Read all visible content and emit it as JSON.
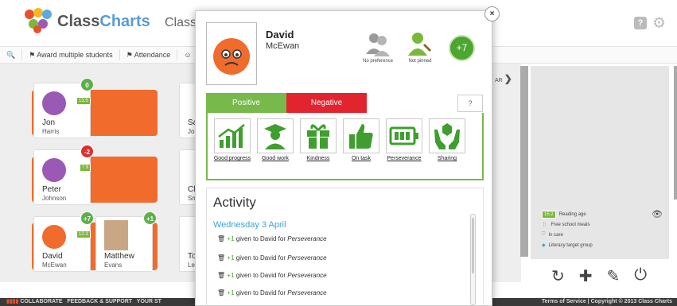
{
  "app": {
    "logo_prefix": "Class",
    "logo_suffix": "Charts",
    "class_title": "Classe",
    "help_label": "?"
  },
  "toolbar": {
    "award_label": "Award multiple students",
    "attendance_label": "Attendance"
  },
  "students": [
    {
      "first": "Jon",
      "last": "Harris",
      "points": "0",
      "reading_age": "13.5",
      "face_color": "#9b59b6",
      "bubble_color": "#5cb04a"
    },
    {
      "first": "Peter",
      "last": "Johnson",
      "points": "-2",
      "reading_age": "7.9",
      "face_color": "#9b59b6",
      "bubble_color": "#d9302f"
    },
    {
      "first": "David",
      "last": "McEwan",
      "points": "+7",
      "reading_age": "12.3",
      "face_color": "#f06b2c",
      "bubble_color": "#5cb04a"
    },
    {
      "first": "Matthew",
      "last": "Evans",
      "points": "+1",
      "reading_age": "",
      "face_color": "",
      "bubble_color": "#5cb04a"
    }
  ],
  "partial_students": [
    {
      "first": "Sa",
      "last": "Jo"
    },
    {
      "first": "Cl",
      "last": "Sm"
    },
    {
      "first": "To",
      "last": "Le"
    }
  ],
  "right_panel": {
    "nav_label": "AR",
    "legend": [
      {
        "badge": "15.2",
        "label": "Reading age"
      },
      {
        "label": "Free school meals"
      },
      {
        "label": "In care"
      },
      {
        "label": "Literacy target group"
      }
    ]
  },
  "footer": {
    "links": [
      "COLLABORATE",
      "FEEDBACK & SUPPORT",
      "YOUR ST"
    ],
    "right_text": "Terms of Service | Copyright © 2013 Class Charts"
  },
  "modal": {
    "close_label": "×",
    "first_name": "David",
    "last_name": "McEwan",
    "preference_label": "No preference",
    "pinned_label": "Not pinned",
    "points": "+7",
    "tab_positive": "Positive",
    "tab_negative": "Negative",
    "tab_help": "?",
    "behaviours": [
      {
        "label": "Good progress",
        "icon": "chart-icon"
      },
      {
        "label": "Good work",
        "icon": "graduate-icon"
      },
      {
        "label": "Kindness",
        "icon": "gift-icon"
      },
      {
        "label": "On task",
        "icon": "thumbs-up-icon"
      },
      {
        "label": "Perseverance",
        "icon": "battery-icon"
      },
      {
        "label": "Sharing",
        "icon": "hands-icon"
      }
    ],
    "activity_title": "Activity",
    "activity_date": "Wednesday 3 April",
    "activity_rows": [
      {
        "points": "+1",
        "text": "given to David for",
        "behaviour": "Perseverance"
      },
      {
        "points": "+1",
        "text": "given to David for",
        "behaviour": "Perseverance"
      },
      {
        "points": "+1",
        "text": "given to David for",
        "behaviour": "Perseverance"
      },
      {
        "points": "+1",
        "text": "given to David for",
        "behaviour": "Perseverance"
      }
    ]
  },
  "colors": {
    "positive": "#77b94a",
    "negative": "#e2242f",
    "accent_blue": "#3ba3d8",
    "orange": "#f06b2c"
  }
}
